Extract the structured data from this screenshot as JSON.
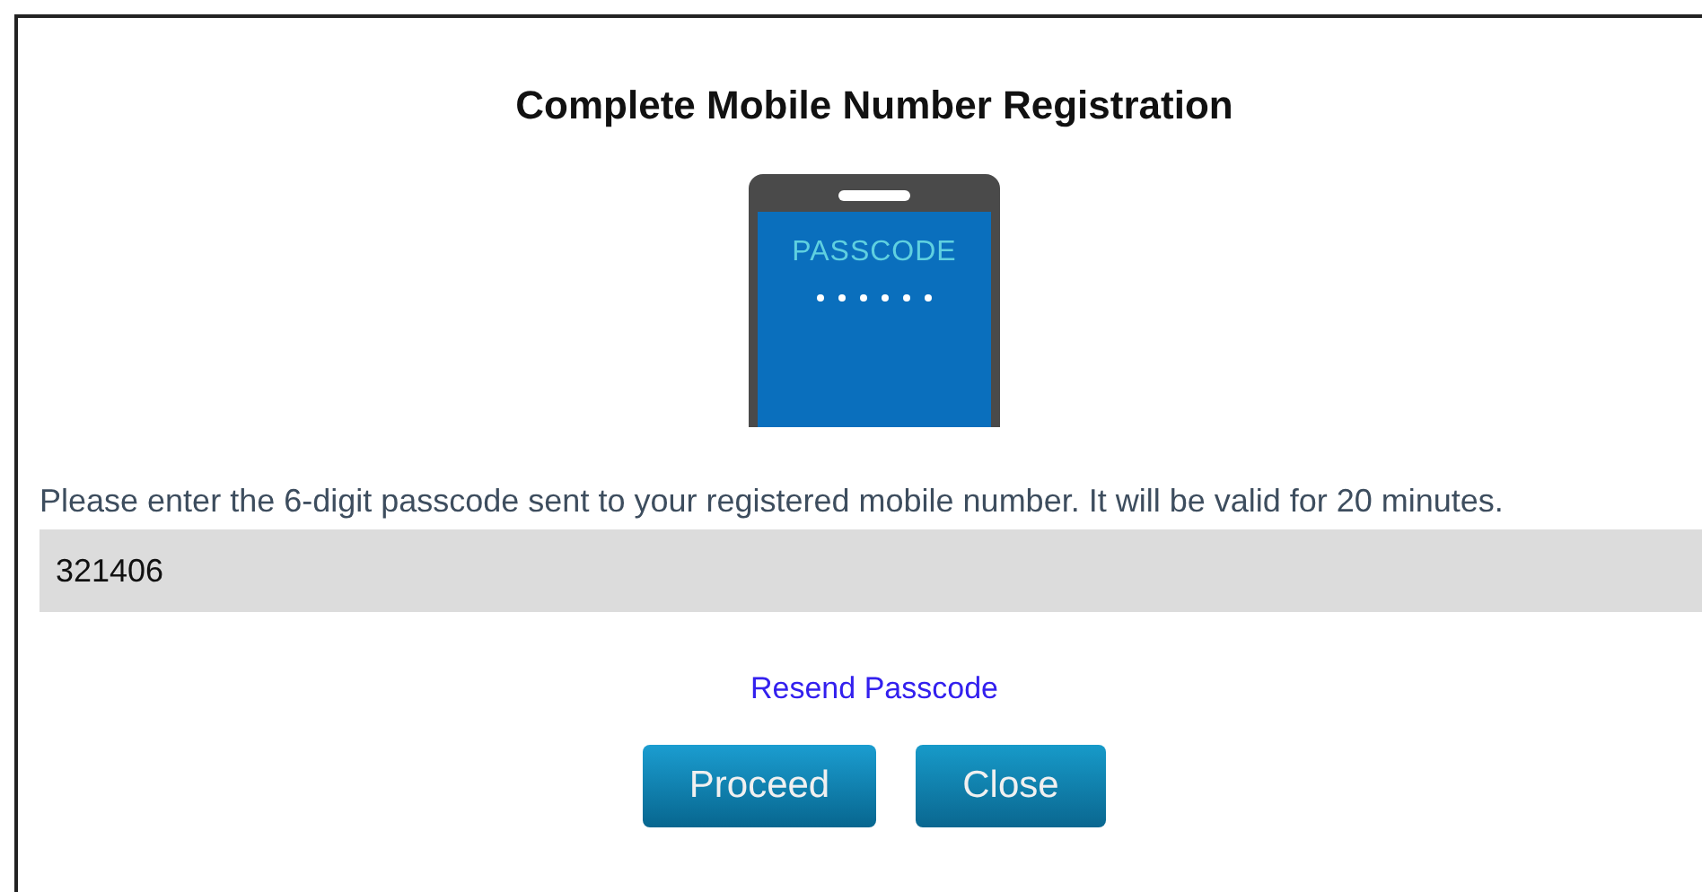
{
  "dialog": {
    "title": "Complete Mobile Number Registration",
    "illustration": {
      "label": "PASSCODE"
    },
    "instructions": "Please enter the 6-digit passcode sent to your registered mobile number. It will be valid for 20 minutes.",
    "passcode_field": {
      "value": "321406"
    },
    "resend_link": "Resend Passcode",
    "buttons": [
      {
        "label": "Proceed",
        "kind": "primary"
      },
      {
        "label": "Close",
        "kind": "secondary"
      }
    ]
  }
}
